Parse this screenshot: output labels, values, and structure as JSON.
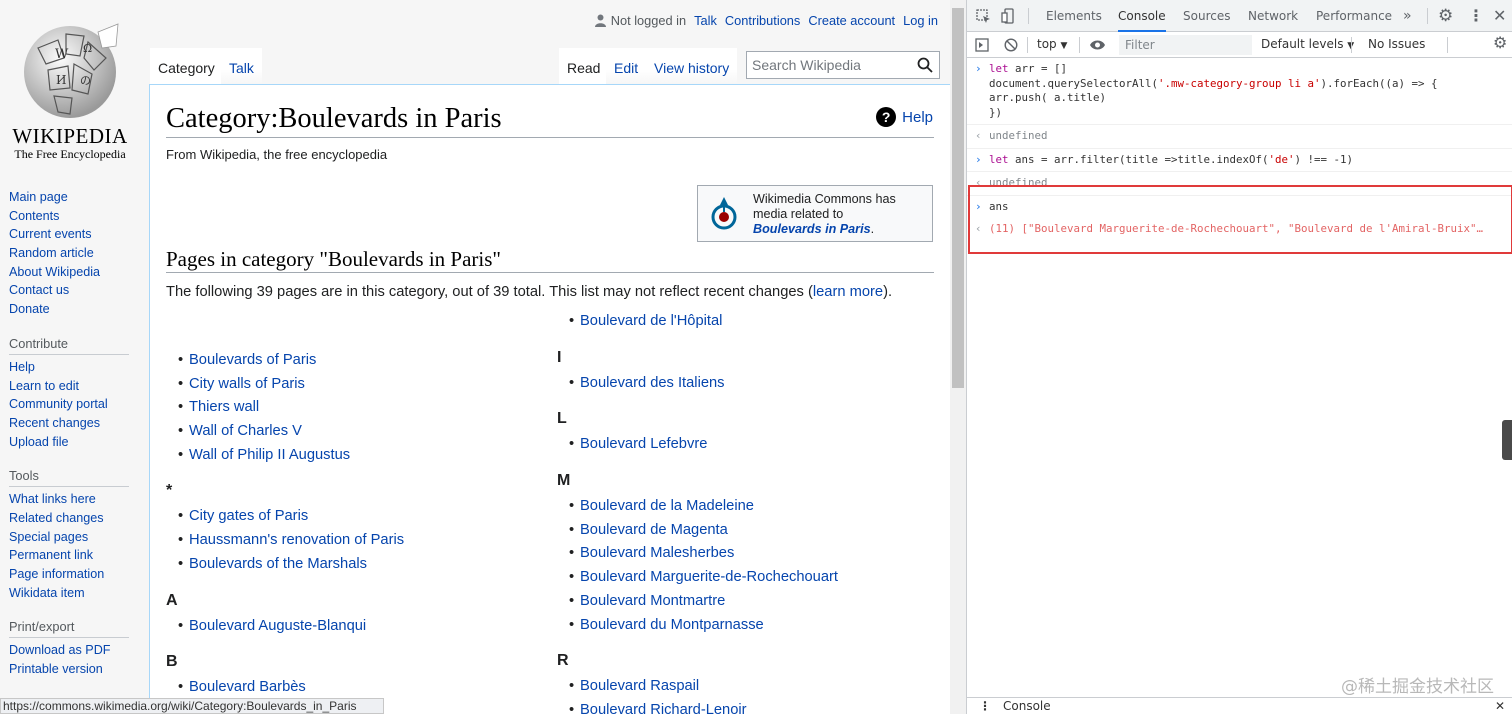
{
  "wiki": {
    "wordmark": "WIKIPEDIA",
    "tagline": "The Free Encyclopedia",
    "nav_main": [
      "Main page",
      "Contents",
      "Current events",
      "Random article",
      "About Wikipedia",
      "Contact us",
      "Donate"
    ],
    "contribute_heading": "Contribute",
    "nav_contribute": [
      "Help",
      "Learn to edit",
      "Community portal",
      "Recent changes",
      "Upload file"
    ],
    "tools_heading": "Tools",
    "nav_tools": [
      "What links here",
      "Related changes",
      "Special pages",
      "Permanent link",
      "Page information",
      "Wikidata item"
    ],
    "print_heading": "Print/export",
    "nav_print": [
      "Download as PDF",
      "Printable version"
    ],
    "personal": {
      "not_logged_in": "Not logged in",
      "talk": "Talk",
      "contributions": "Contributions",
      "create_account": "Create account",
      "log_in": "Log in"
    },
    "tabs": {
      "category": "Category",
      "talk": "Talk",
      "read": "Read",
      "edit": "Edit",
      "view_history": "View history"
    },
    "search_placeholder": "Search Wikipedia",
    "title": "Category:Boulevards in Paris",
    "help": "Help",
    "from": "From Wikipedia, the free encyclopedia",
    "commons": {
      "line1": "Wikimedia Commons has",
      "line2": "media related to",
      "link": "Boulevards in Paris",
      "period": "."
    },
    "section_heading": "Pages in category \"Boulevards in Paris\"",
    "summary_text": "The following 39 pages are in this category, out of 39 total. This list may not reflect recent changes (",
    "summary_link": "learn more",
    "summary_end": ").",
    "col1_pre": [
      "Boulevards of Paris",
      "City walls of Paris",
      "Thiers wall",
      "Wall of Charles V",
      "Wall of Philip II Augustus"
    ],
    "col1_star": "*",
    "col1_star_items": [
      "City gates of Paris",
      "Haussmann's renovation of Paris",
      "Boulevards of the Marshals"
    ],
    "col1_A": "A",
    "col1_A_items": [
      "Boulevard Auguste-Blanqui"
    ],
    "col1_B": "B",
    "col1_B_items": [
      "Boulevard Barbès"
    ],
    "col2_top": [
      "Boulevard de l'Hôpital"
    ],
    "col2_I": "I",
    "col2_I_items": [
      "Boulevard des Italiens"
    ],
    "col2_L": "L",
    "col2_L_items": [
      "Boulevard Lefebvre"
    ],
    "col2_M": "M",
    "col2_M_items": [
      "Boulevard de la Madeleine",
      "Boulevard de Magenta",
      "Boulevard Malesherbes",
      "Boulevard Marguerite-de-Rochechouart",
      "Boulevard Montmartre",
      "Boulevard du Montparnasse"
    ],
    "col2_R": "R",
    "col2_R_items": [
      "Boulevard Raspail",
      "Boulevard Richard-Lenoir"
    ],
    "status_url": "https://commons.wikimedia.org/wiki/Category:Boulevards_in_Paris"
  },
  "devtools": {
    "tabs": [
      "Elements",
      "Console",
      "Sources",
      "Network",
      "Performance"
    ],
    "more": "»",
    "context": "top",
    "filter_placeholder": "Filter",
    "levels": "Default levels",
    "issues": "No Issues",
    "lines": [
      {
        "type": "in",
        "text": "let arr = []\ndocument.querySelectorAll('.mw-category-group li a').forEach((a) => {\narr.push( a.title)\n})"
      },
      {
        "type": "out",
        "text": "undefined"
      },
      {
        "type": "in",
        "text": "let ans = arr.filter(title =>title.indexOf('de') !== -1)"
      },
      {
        "type": "out",
        "text": "undefined"
      },
      {
        "type": "in",
        "text": "ans"
      },
      {
        "type": "res",
        "text": "(11) [\"Boulevard Marguerite-de-Rochechouart\", \"Boulevard de l'Amiral-Bruix\"…"
      }
    ],
    "drawer_tab": "Console",
    "watermark": "@稀土掘金技术社区"
  }
}
